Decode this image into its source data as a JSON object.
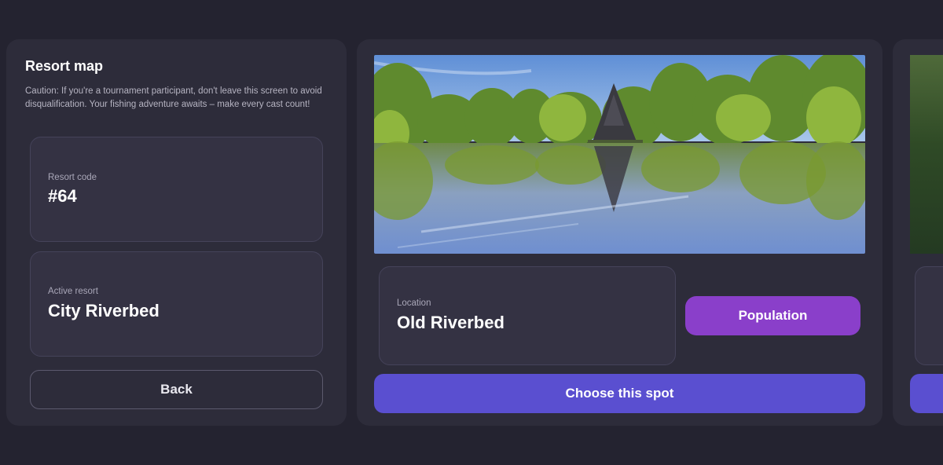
{
  "resort_panel": {
    "title": "Resort map",
    "caution": "Caution: If you're a tournament participant, don't leave this screen to avoid disqualification. Your fishing adventure awaits – make every cast count!",
    "code_label": "Resort code",
    "code_value": "#64",
    "active_label": "Active resort",
    "active_value": "City Riverbed",
    "back_label": "Back"
  },
  "spot": {
    "image": "lake-photo",
    "location_label": "Location",
    "location_value": "Old Riverbed",
    "population_label": "Population",
    "choose_label": "Choose this spot"
  },
  "colors": {
    "background": "#242330",
    "panel": "#2d2c3a",
    "population_button": "#8a3fca",
    "choose_button": "#5a4fd0"
  }
}
